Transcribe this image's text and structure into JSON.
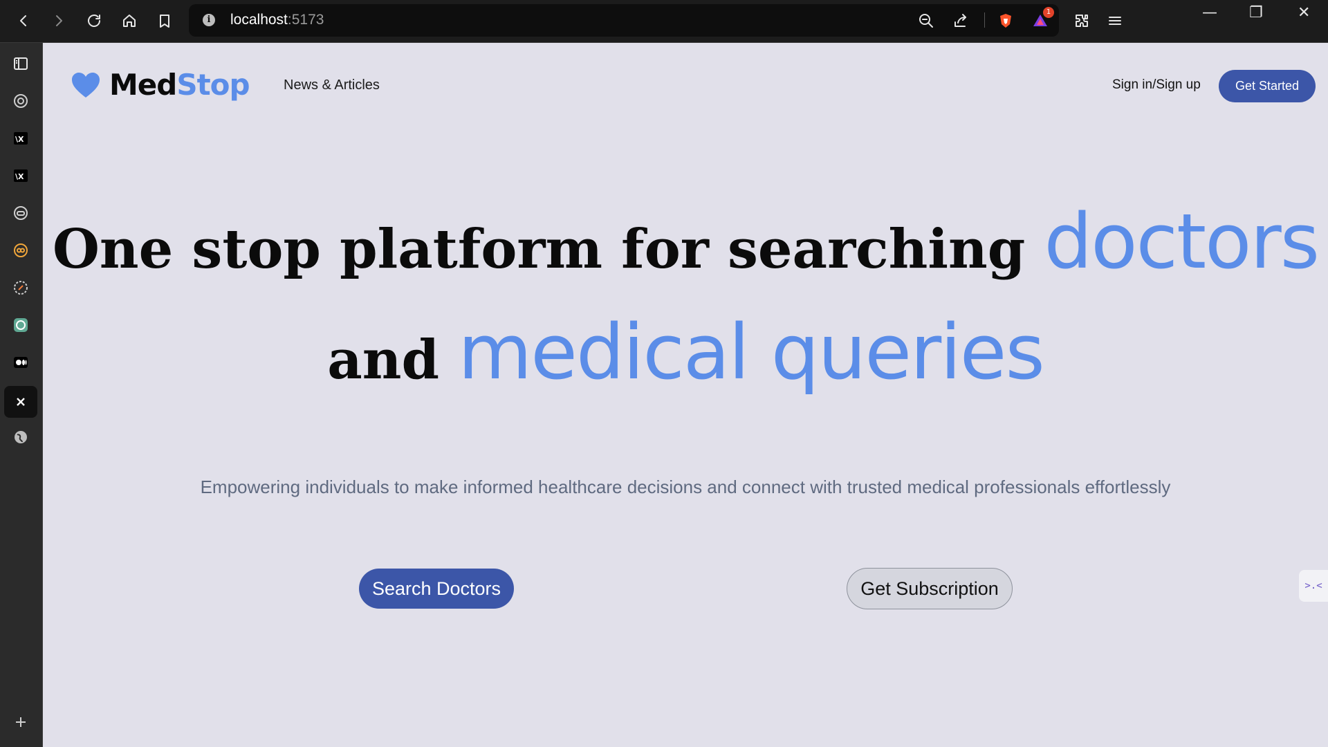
{
  "browser": {
    "url_host": "localhost",
    "url_port": ":5173",
    "brave_badge_count": "1",
    "toolbar_icons": [
      "back-icon",
      "forward-icon",
      "reload-icon",
      "home-icon",
      "bookmark-icon",
      "zoom-out-icon",
      "share-icon",
      "brave-shield-icon",
      "brave-rewards-icon",
      "extensions-icon",
      "menu-icon"
    ],
    "window_controls": {
      "minimize": "—",
      "restore": "❐",
      "close": "✕"
    }
  },
  "sidebar": {
    "items": [
      {
        "icon": "sidebar-panel-icon"
      },
      {
        "icon": "github-icon"
      },
      {
        "icon": "app-x-icon"
      },
      {
        "icon": "app-x-icon-2"
      },
      {
        "icon": "gamepad-icon"
      },
      {
        "icon": "infinity-icon"
      },
      {
        "icon": "compass-icon"
      },
      {
        "icon": "chatgpt-icon"
      },
      {
        "icon": "medium-icon"
      },
      {
        "icon": "x-twitter-icon"
      },
      {
        "icon": "globe-icon"
      },
      {
        "icon": "add-icon"
      }
    ]
  },
  "site": {
    "logo_med": "Med",
    "logo_stop": "Stop",
    "nav_news": "News & Articles",
    "nav_signin": "Sign in/Sign up",
    "get_started": "Get Started",
    "hero_line1_dark": "One stop platform for searching ",
    "hero_line1_accent": "doctors",
    "hero_line2_dark": "and ",
    "hero_line2_accent": "medical queries",
    "subtitle": "Empowering individuals to make informed healthcare decisions and connect with trusted medical professionals effortlessly",
    "btn_search": "Search Doctors",
    "btn_subscription": "Get Subscription",
    "side_tab_glyph": ">.<"
  },
  "colors": {
    "accent": "#5b8de8",
    "primary_button": "#3c56a8",
    "page_background": "#e1e0ea"
  }
}
